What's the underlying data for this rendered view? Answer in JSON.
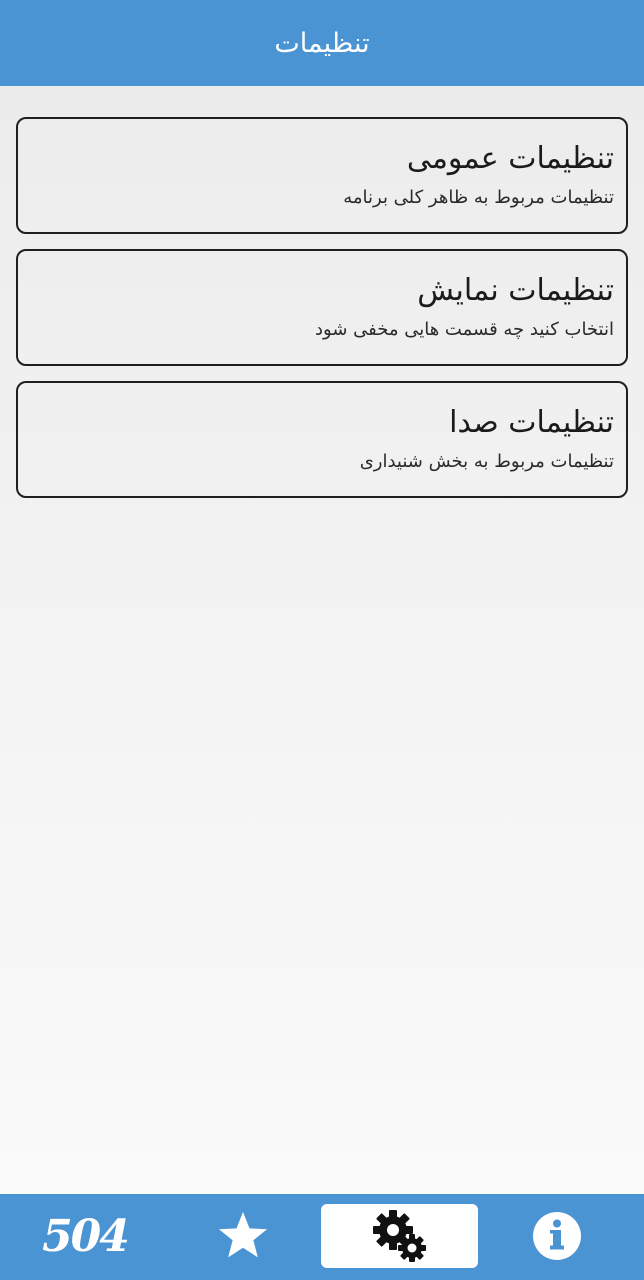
{
  "header": {
    "title": "تنظیمات"
  },
  "settings_items": [
    {
      "title": "تنظیمات عمومی",
      "subtitle": "تنظیمات مربوط به ظاهر کلی برنامه"
    },
    {
      "title": "تنظیمات نمایش",
      "subtitle": "انتخاب کنید چه قسمت هایی مخفی شود"
    },
    {
      "title": "تنظیمات صدا",
      "subtitle": "تنظیمات مربوط به بخش شنیداری"
    }
  ],
  "bottom_nav": {
    "words_label": "504",
    "items": [
      {
        "icon": "words-504-icon"
      },
      {
        "icon": "star-icon"
      },
      {
        "icon": "gears-icon",
        "active": true
      },
      {
        "icon": "info-icon"
      }
    ]
  },
  "colors": {
    "primary": "#4a94d3",
    "active_tab_bg": "#ffffff",
    "card_border": "#1f1f1f"
  }
}
